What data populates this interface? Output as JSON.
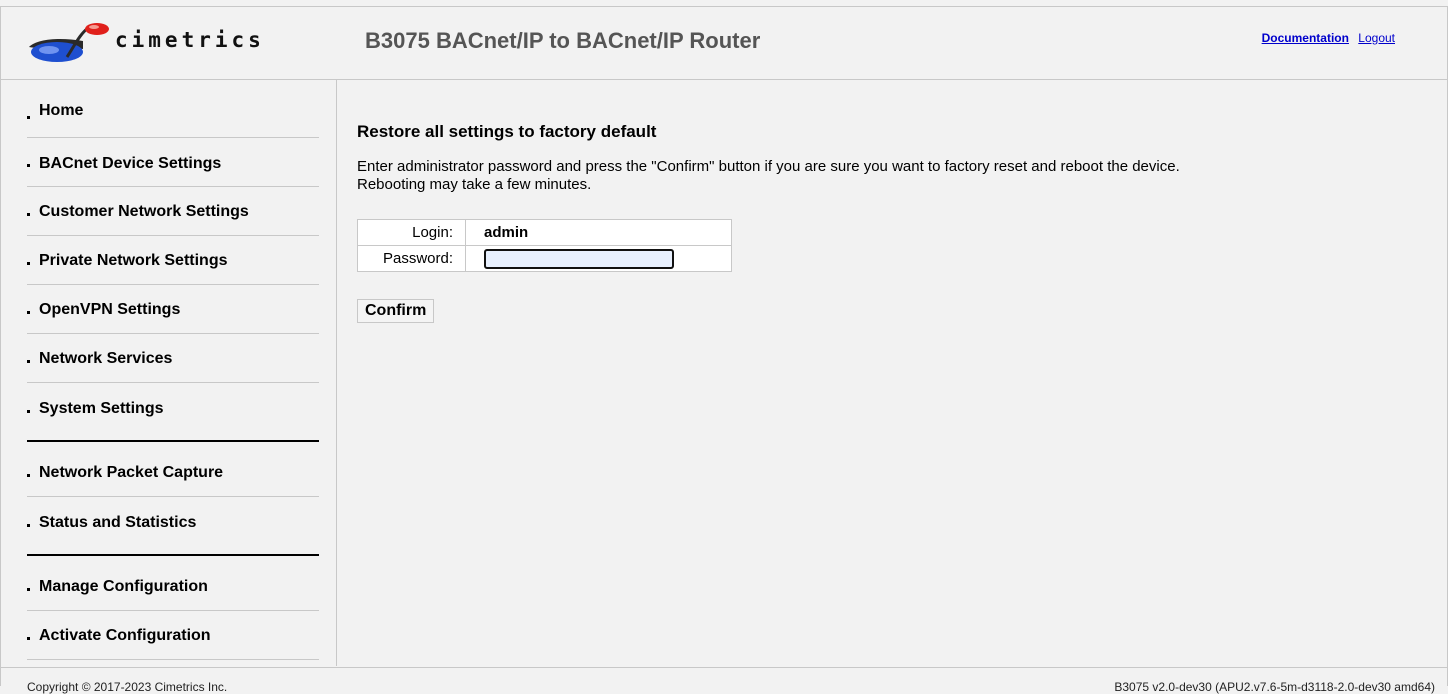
{
  "header": {
    "logo_text": "cimetrics",
    "title": "B3075 BACnet/IP to BACnet/IP Router",
    "documentation_link": "Documentation",
    "logout_link": "Logout"
  },
  "sidebar": {
    "items": [
      {
        "label": "Home"
      },
      {
        "label": "BACnet Device Settings"
      },
      {
        "label": "Customer Network Settings"
      },
      {
        "label": "Private Network Settings"
      },
      {
        "label": "OpenVPN Settings"
      },
      {
        "label": "Network Services"
      },
      {
        "label": "System Settings"
      },
      {
        "label": "Network Packet Capture"
      },
      {
        "label": "Status and Statistics"
      },
      {
        "label": "Manage Configuration"
      },
      {
        "label": "Activate Configuration"
      }
    ]
  },
  "main": {
    "title": "Restore all settings to factory default",
    "description_line1": "Enter administrator password and press the \"Confirm\" button if you are sure you want to factory reset and reboot the device.",
    "description_line2": "Rebooting may take a few minutes.",
    "login_label": "Login:",
    "login_value": "admin",
    "password_label": "Password:",
    "password_value": "",
    "confirm_label": "Confirm"
  },
  "footer": {
    "copyright": "Copyright © 2017-2023 Cimetrics Inc.",
    "version": "B3075 v2.0-dev30 (APU2.v7.6-5m-d3118-2.0-dev30 amd64)"
  },
  "colors": {
    "background": "#f2f2f2",
    "link": "#0000cc",
    "logo_blue": "#1e4fd0",
    "logo_red": "#e0201b"
  }
}
